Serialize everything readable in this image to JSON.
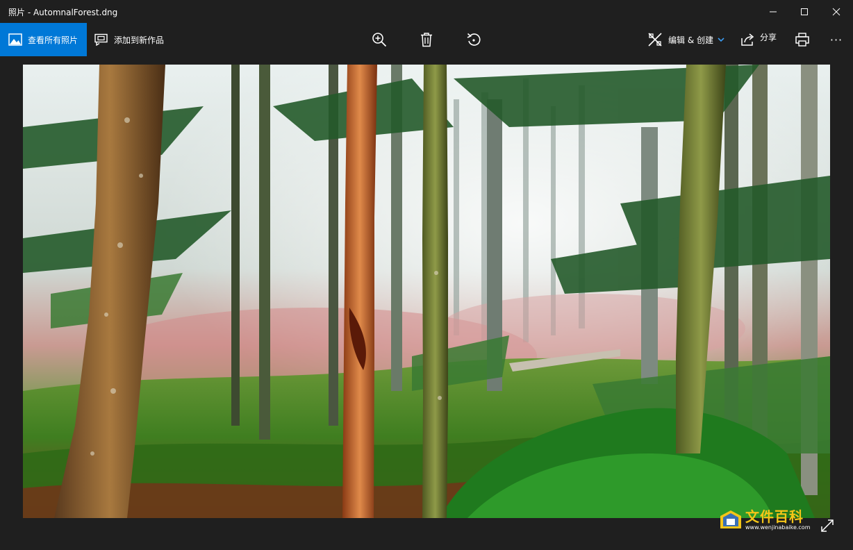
{
  "window": {
    "title": "照片 - AutomnalForest.dng",
    "minimize_icon": "minimize-icon",
    "maximize_icon": "maximize-icon",
    "close_icon": "close-icon"
  },
  "toolbar": {
    "see_all_label": "查看所有照片",
    "add_to_creation_label": "添加到新作品",
    "zoom_icon": "zoom-in-icon",
    "delete_icon": "trash-icon",
    "rotate_icon": "rotate-icon",
    "edit_create_label": "编辑 & 创建",
    "share_label": "分享",
    "print_icon": "printer-icon",
    "more_label": "···"
  },
  "watermark": {
    "title": "文件百科",
    "url": "www.wenjinabaike.com"
  },
  "colors": {
    "background": "#1f1f1f",
    "accent": "#0078d7",
    "watermark_yellow": "#f5c518"
  }
}
